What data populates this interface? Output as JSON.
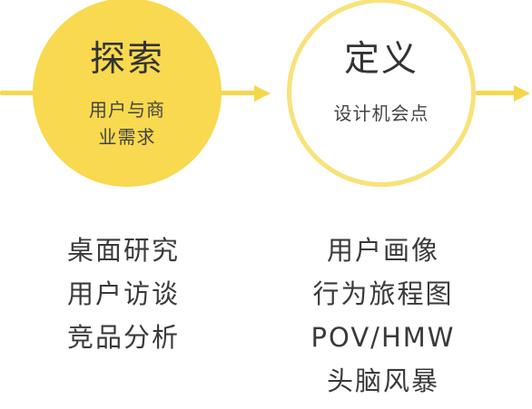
{
  "stages": [
    {
      "title": "探索",
      "desc_line1": "用户与商",
      "desc_line2": "业需求",
      "activities": [
        "桌面研究",
        "用户访谈",
        "竞品分析"
      ]
    },
    {
      "title": "定义",
      "desc_line1": "设计机会点",
      "desc_line2": "",
      "activities": [
        "用户画像",
        "行为旅程图",
        "POV/HMW",
        "头脑风暴"
      ]
    }
  ],
  "colors": {
    "accent": "#f8d94f",
    "accent_outline": "#f8e27a",
    "text": "#333333"
  }
}
